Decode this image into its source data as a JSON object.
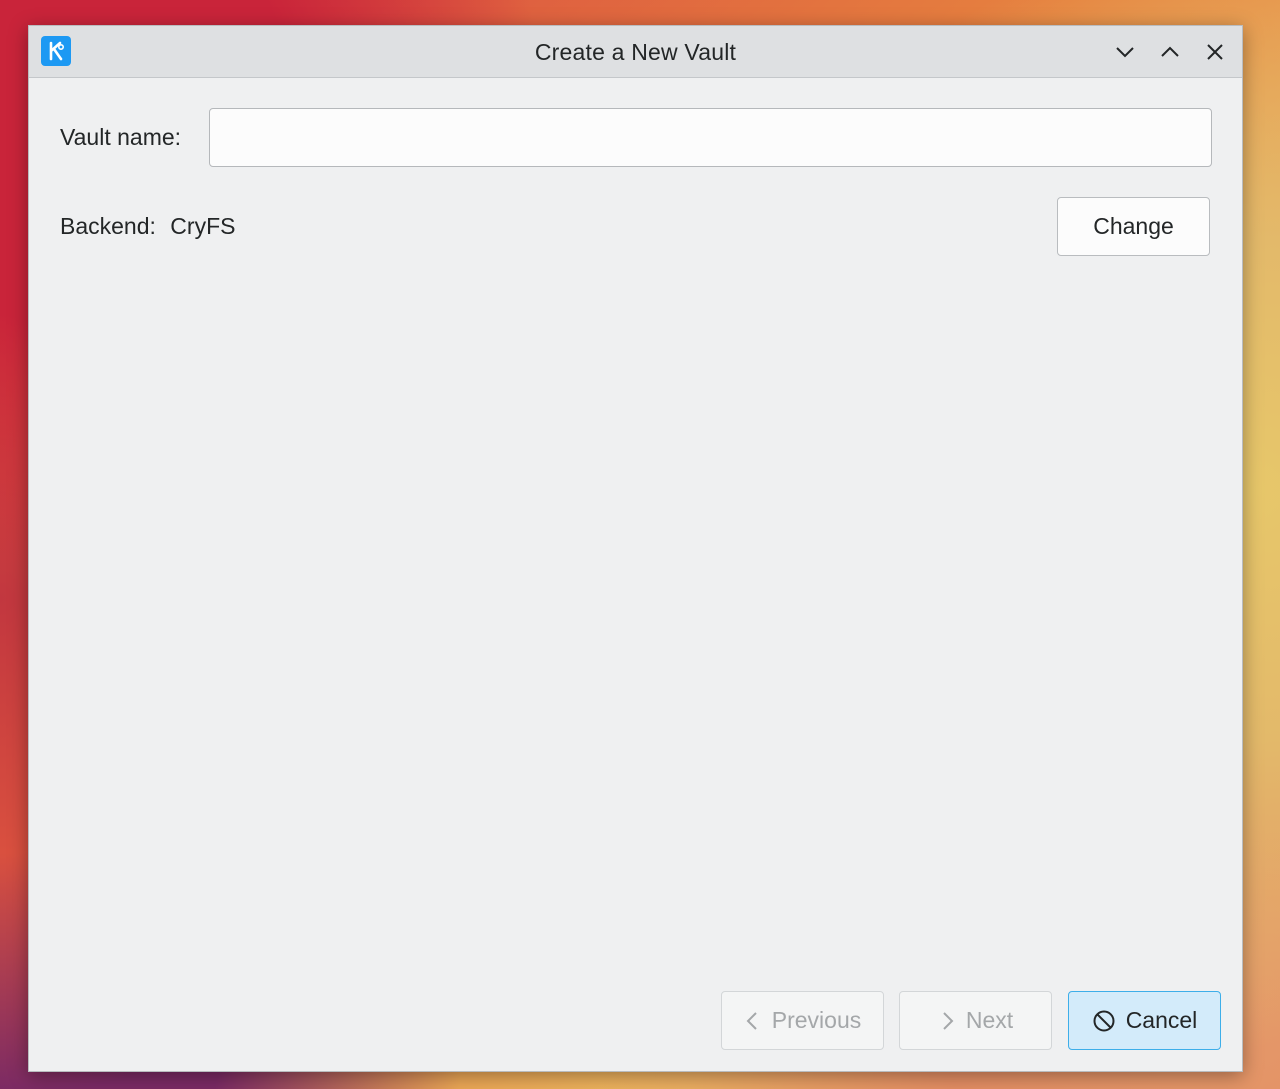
{
  "window": {
    "title": "Create a New Vault",
    "app_icon": "kde-logo-icon",
    "controls": [
      "minimize-icon",
      "maximize-icon",
      "close-icon"
    ]
  },
  "form": {
    "vault_name_label": "Vault name:",
    "vault_name_value": "",
    "backend_label": "Backend:",
    "backend_value": "CryFS",
    "change_label": "Change"
  },
  "footer": {
    "previous_label": "Previous",
    "next_label": "Next",
    "cancel_label": "Cancel"
  },
  "colors": {
    "accent": "#3daee9",
    "window_bg": "#eff0f1",
    "titlebar_bg": "#dee0e2"
  }
}
